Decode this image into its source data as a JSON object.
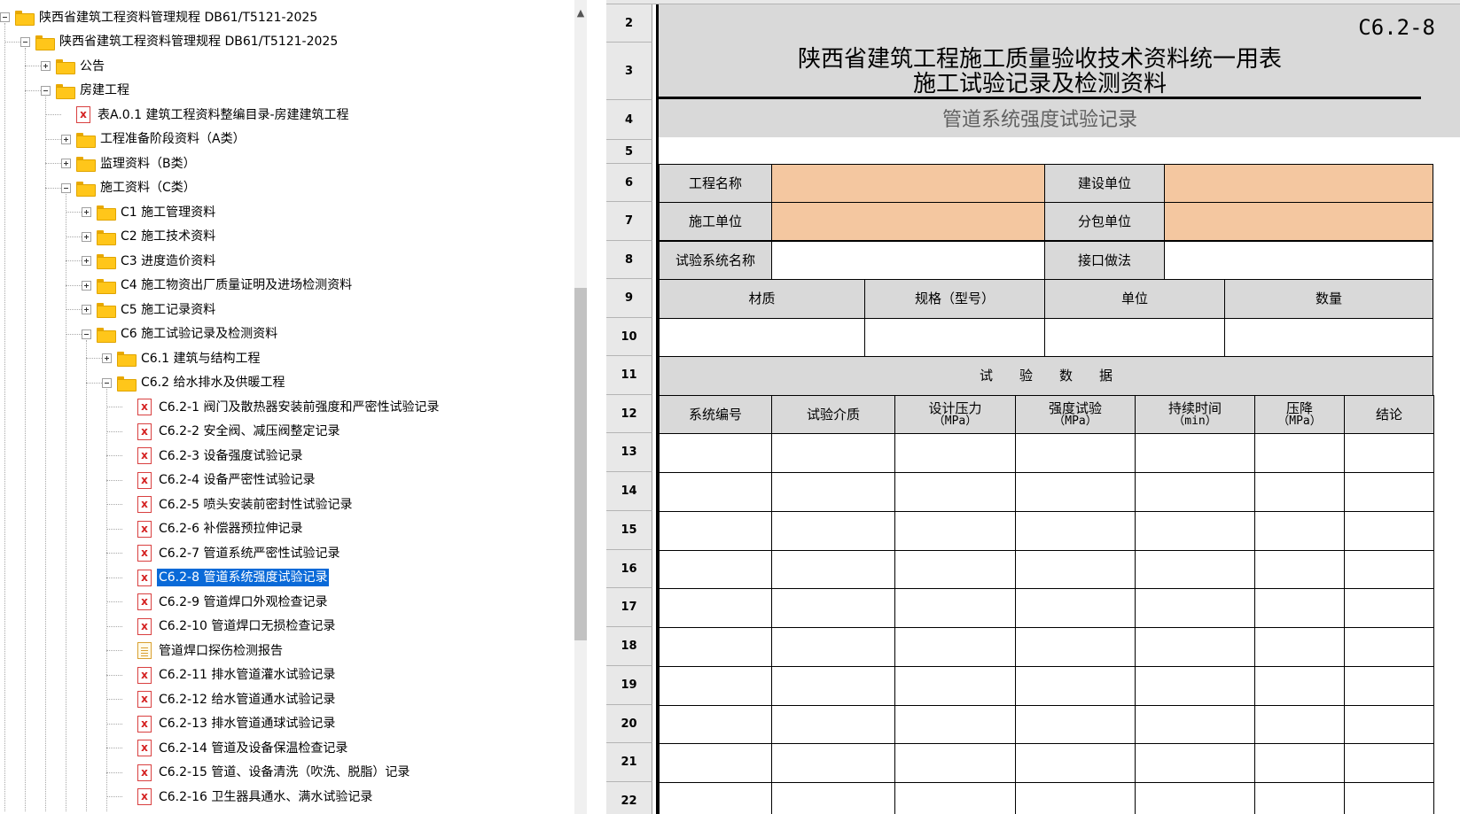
{
  "tree": {
    "items": [
      {
        "label": "陕西省建筑工程资料管理规程 DB61/T5121-2025",
        "icon": "folder",
        "expander": "minus",
        "depth": 0
      },
      {
        "label": "陕西省建筑工程资料管理规程 DB61/T5121-2025",
        "icon": "folder",
        "expander": "minus",
        "depth": 1
      },
      {
        "label": "公告",
        "icon": "folder",
        "expander": "plus",
        "depth": 2
      },
      {
        "label": "房建工程",
        "icon": "folder",
        "expander": "minus",
        "depth": 2
      },
      {
        "label": "表A.0.1 建筑工程资料整编目录-房建建筑工程",
        "icon": "xdoc",
        "expander": "none",
        "depth": 3
      },
      {
        "label": "工程准备阶段资料（A类）",
        "icon": "folder",
        "expander": "plus",
        "depth": 3
      },
      {
        "label": "监理资料（B类）",
        "icon": "folder",
        "expander": "plus",
        "depth": 3
      },
      {
        "label": "施工资料（C类）",
        "icon": "folder",
        "expander": "minus",
        "depth": 3
      },
      {
        "label": "C1 施工管理资料",
        "icon": "folder",
        "expander": "plus",
        "depth": 4
      },
      {
        "label": "C2 施工技术资料",
        "icon": "folder",
        "expander": "plus",
        "depth": 4
      },
      {
        "label": "C3 进度造价资料",
        "icon": "folder",
        "expander": "plus",
        "depth": 4
      },
      {
        "label": "C4 施工物资出厂质量证明及进场检测资料",
        "icon": "folder",
        "expander": "plus",
        "depth": 4
      },
      {
        "label": "C5 施工记录资料",
        "icon": "folder",
        "expander": "plus",
        "depth": 4
      },
      {
        "label": "C6 施工试验记录及检测资料",
        "icon": "folder",
        "expander": "minus",
        "depth": 4
      },
      {
        "label": "C6.1 建筑与结构工程",
        "icon": "folder",
        "expander": "plus",
        "depth": 5
      },
      {
        "label": "C6.2 给水排水及供暖工程",
        "icon": "folder",
        "expander": "minus",
        "depth": 5
      },
      {
        "label": "C6.2-1 阀门及散热器安装前强度和严密性试验记录",
        "icon": "xdoc",
        "expander": "none",
        "depth": 6
      },
      {
        "label": "C6.2-2 安全阀、减压阀整定记录",
        "icon": "xdoc",
        "expander": "none",
        "depth": 6
      },
      {
        "label": "C6.2-3 设备强度试验记录",
        "icon": "xdoc",
        "expander": "none",
        "depth": 6
      },
      {
        "label": "C6.2-4 设备严密性试验记录",
        "icon": "xdoc",
        "expander": "none",
        "depth": 6
      },
      {
        "label": "C6.2-5 喷头安装前密封性试验记录",
        "icon": "xdoc",
        "expander": "none",
        "depth": 6
      },
      {
        "label": "C6.2-6 补偿器预拉伸记录",
        "icon": "xdoc",
        "expander": "none",
        "depth": 6
      },
      {
        "label": "C6.2-7 管道系统严密性试验记录",
        "icon": "xdoc",
        "expander": "none",
        "depth": 6
      },
      {
        "label": "C6.2-8 管道系统强度试验记录",
        "icon": "xdoc",
        "expander": "none",
        "depth": 6,
        "selected": true
      },
      {
        "label": "C6.2-9 管道焊口外观检查记录",
        "icon": "xdoc",
        "expander": "none",
        "depth": 6
      },
      {
        "label": "C6.2-10 管道焊口无损检查记录",
        "icon": "xdoc",
        "expander": "none",
        "depth": 6
      },
      {
        "label": "管道焊口探伤检测报告",
        "icon": "report",
        "expander": "none",
        "depth": 6
      },
      {
        "label": "C6.2-11 排水管道灌水试验记录",
        "icon": "xdoc",
        "expander": "none",
        "depth": 6
      },
      {
        "label": "C6.2-12 给水管道通水试验记录",
        "icon": "xdoc",
        "expander": "none",
        "depth": 6
      },
      {
        "label": "C6.2-13 排水管道通球试验记录",
        "icon": "xdoc",
        "expander": "none",
        "depth": 6
      },
      {
        "label": "C6.2-14 管道及设备保温检查记录",
        "icon": "xdoc",
        "expander": "none",
        "depth": 6
      },
      {
        "label": "C6.2-15 管道、设备清洗（吹洗、脱脂）记录",
        "icon": "xdoc",
        "expander": "none",
        "depth": 6
      },
      {
        "label": "C6.2-16 卫生器具通水、满水试验记录",
        "icon": "xdoc",
        "expander": "none",
        "depth": 6
      }
    ]
  },
  "sheet": {
    "row_numbers": [
      "2",
      "3",
      "4",
      "5",
      "6",
      "7",
      "8",
      "9",
      "10",
      "11",
      "12",
      "13",
      "14",
      "15",
      "16",
      "17",
      "18",
      "19",
      "20",
      "21",
      "22"
    ],
    "form_code": "C6.2-8",
    "title_line_1": "陕西省建筑工程施工质量验收技术资料统一用表",
    "title_line_2": "施工试验记录及检测资料",
    "subtitle": "管道系统强度试验记录",
    "labels": {
      "project_name": "工程名称",
      "construction_unit": "建设单位",
      "contractor": "施工单位",
      "subcontractor": "分包单位",
      "test_system_name": "试验系统名称",
      "joint_method": "接口做法",
      "material": "材质",
      "spec_model": "规格（型号）",
      "unit": "单位",
      "quantity": "数量",
      "test_data": "试　　验　　数　　据"
    },
    "data_headers": [
      {
        "line1": "系统编号",
        "line2": ""
      },
      {
        "line1": "试验介质",
        "line2": ""
      },
      {
        "line1": "设计压力",
        "line2": "（MPa）"
      },
      {
        "line1": "强度试验",
        "line2": "（MPa）"
      },
      {
        "line1": "持续时间",
        "line2": "（min）"
      },
      {
        "line1": "压降",
        "line2": "（MPa）"
      },
      {
        "line1": "结论",
        "line2": ""
      }
    ],
    "colors": {
      "header_gray": "#d9d9d9",
      "input_peach": "#f4c7a0",
      "selection_blue": "#0a6ad8"
    }
  }
}
